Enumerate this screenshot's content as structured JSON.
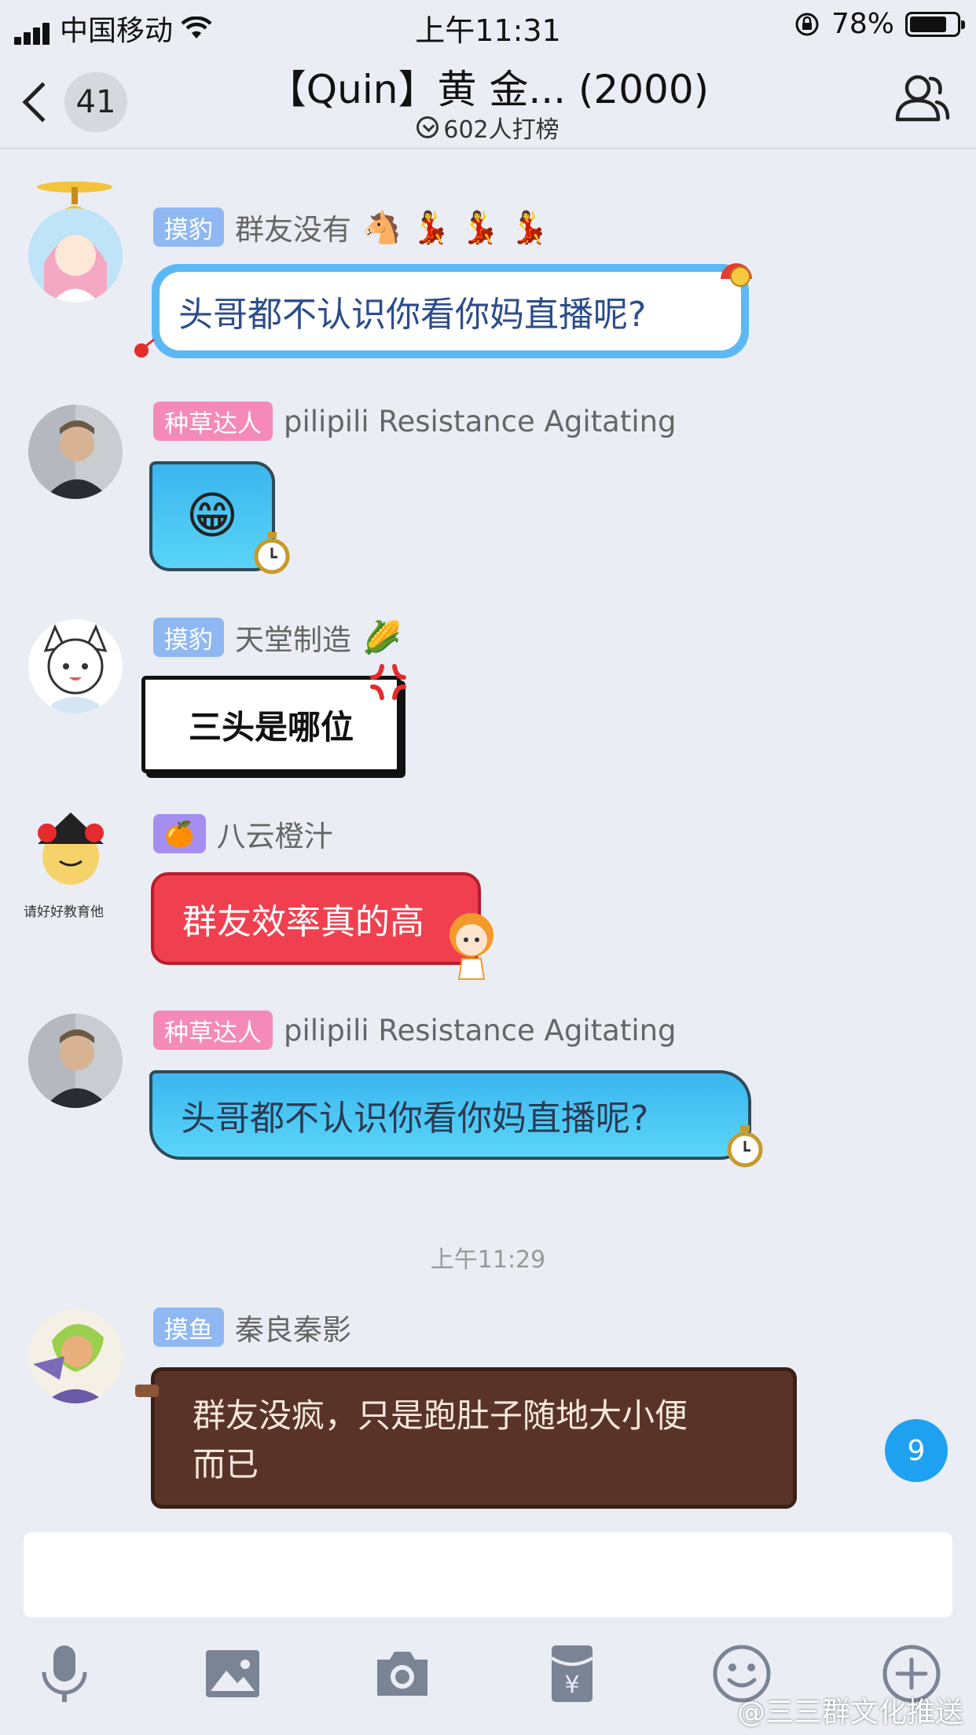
{
  "status_bar": {
    "carrier": "中国移动",
    "time": "上午11:31",
    "battery": "78%"
  },
  "nav": {
    "back_count": "41",
    "title": "【Quin】黄 金... (2000)",
    "subtitle": "602人打榜"
  },
  "messages": [
    {
      "tag": "摸豹",
      "name": "群友没有",
      "emojis": "🐴 💃 💃 💃",
      "text": "头哥都不认识你看你妈直播呢?"
    },
    {
      "tag": "种草达人",
      "name": "pilipili Resistance Agitating",
      "text": "😁"
    },
    {
      "tag": "摸豹",
      "name": "天堂制造",
      "emojis": "🌽",
      "text": "三头是哪位"
    },
    {
      "tag": "🍊",
      "name": "八云橙汁",
      "text": "群友效率真的高"
    },
    {
      "tag": "种草达人",
      "name": "pilipili Resistance Agitating",
      "text": "头哥都不认识你看你妈直播呢?"
    },
    {
      "tag": "摸鱼",
      "name": "秦良秦影",
      "text_line1": "群友没疯，只是跑肚子随地大小便",
      "text_line2": "而已"
    }
  ],
  "time_divider": "上午11:29",
  "new_messages_count": "9",
  "toolbar": [
    "mic-icon",
    "image-icon",
    "camera-icon",
    "red-packet-icon",
    "emoji-icon",
    "plus-icon"
  ],
  "watermark": "@三三群文化推送",
  "avatar_caption": "请好好教育他"
}
